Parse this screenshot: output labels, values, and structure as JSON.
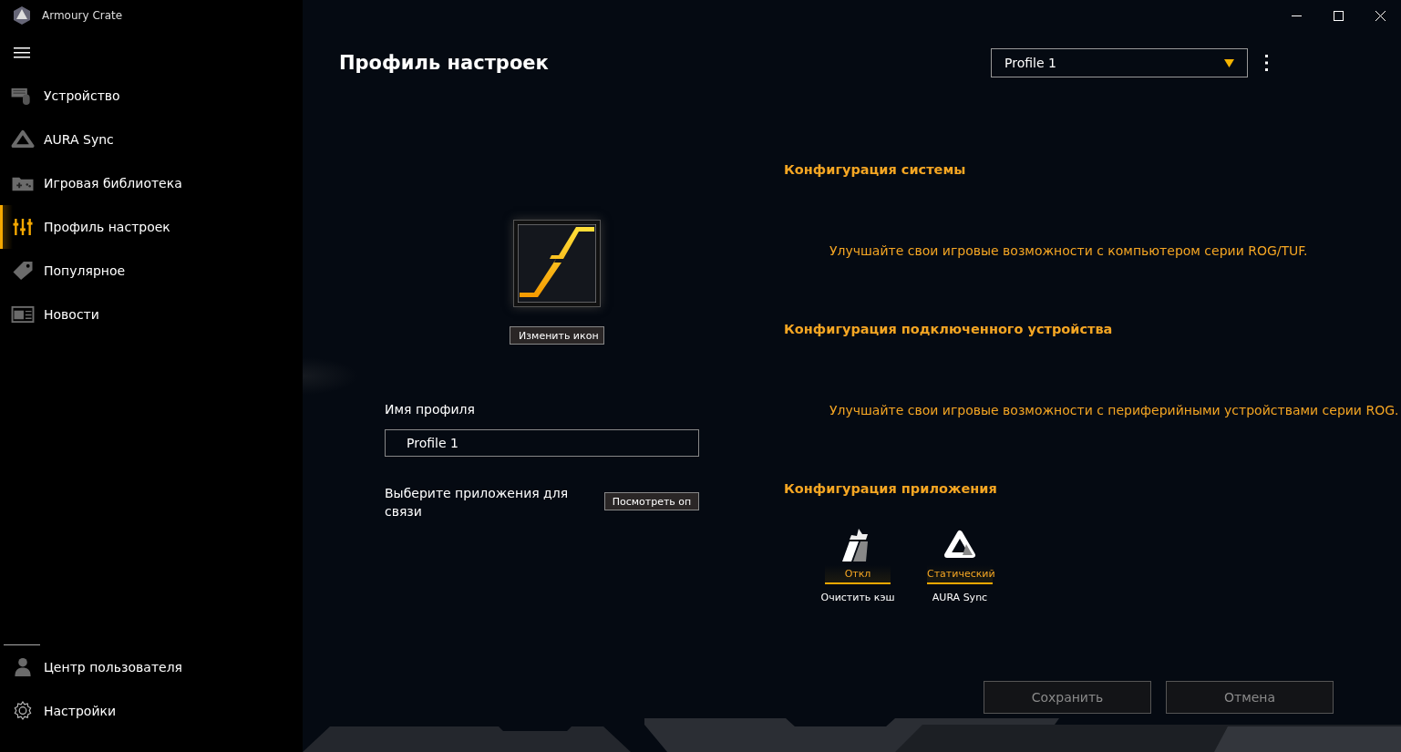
{
  "window": {
    "title": "Armoury Crate"
  },
  "sidebar": {
    "items": [
      {
        "label": "Устройство",
        "selected": false
      },
      {
        "label": "AURA Sync",
        "selected": false
      },
      {
        "label": "Игровая библиотека",
        "selected": false
      },
      {
        "label": "Профиль настроек",
        "selected": true
      },
      {
        "label": "Популярное",
        "selected": false
      },
      {
        "label": "Новости",
        "selected": false
      }
    ],
    "footer_items": [
      {
        "label": "Центр пользователя",
        "selected": false
      },
      {
        "label": "Настройки",
        "selected": false
      }
    ]
  },
  "page": {
    "title": "Профиль настроек",
    "profile_select": {
      "value": "Profile 1"
    }
  },
  "profile_icon": {
    "button": "Изменить икон"
  },
  "profile_name": {
    "label": "Имя профиля",
    "value": "Profile 1"
  },
  "link_apps": {
    "label": "Выберите приложения для связи",
    "button": "Посмотреть оп"
  },
  "sections": [
    {
      "heading": "Конфигурация системы",
      "description": "Улучшайте свои игровые возможности с компьютером серии ROG/TUF."
    },
    {
      "heading": "Конфигурация подключенного устройства",
      "description": "Улучшайте свои игровые возможности с периферийными устройствами серии ROG."
    },
    {
      "heading": "Конфигурация приложения",
      "apps": [
        {
          "status": "Откл",
          "name": "Очистить кэш"
        },
        {
          "status": "Статический",
          "name": "AURA Sync"
        }
      ]
    }
  ],
  "buttons": [
    {
      "label": "Сохранить",
      "disabled": true
    },
    {
      "label": "Отмена",
      "disabled": true
    }
  ]
}
